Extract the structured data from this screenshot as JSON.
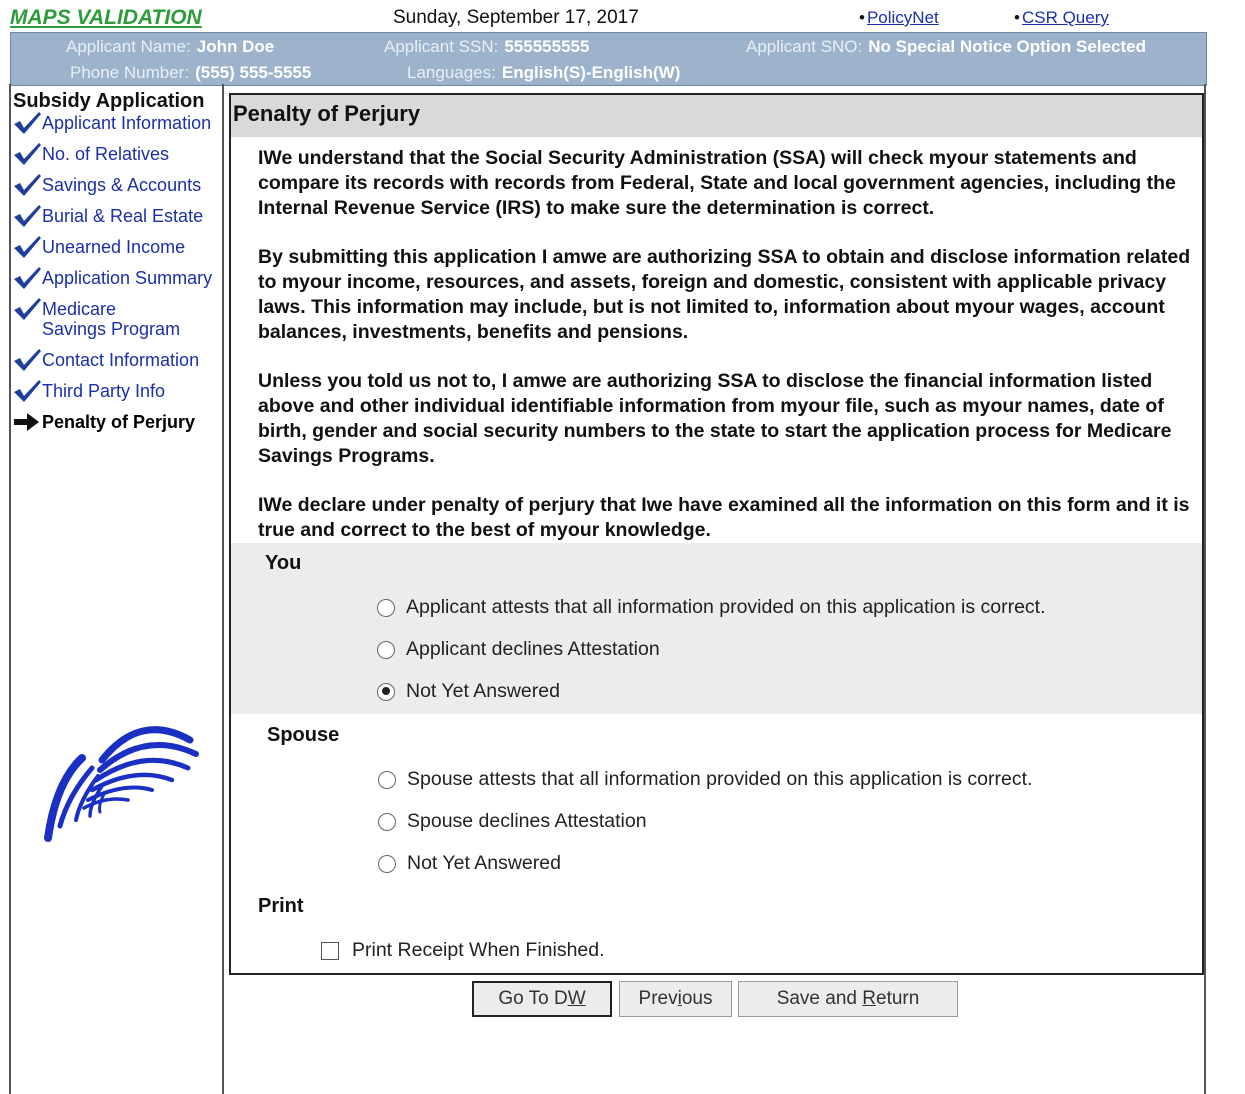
{
  "header": {
    "app_title": "MAPS VALIDATION",
    "date": "Sunday, September 17, 2017",
    "links": [
      {
        "bullet": "•",
        "label": "PolicyNet"
      },
      {
        "bullet": "•",
        "label": "CSR Query"
      }
    ]
  },
  "applicant": {
    "name_label": "Applicant Name:",
    "name_value": "John Doe",
    "ssn_label": "Applicant SSN:",
    "ssn_value": "555555555",
    "sno_label": "Applicant SNO:",
    "sno_value": "No Special Notice Option Selected",
    "phone_label": "Phone Number:",
    "phone_value": "(555) 555-5555",
    "languages_label": "Languages:",
    "languages_value": "English(S)-English(W)"
  },
  "sidebar": {
    "title": "Subsidy Application",
    "items": [
      {
        "label": "Applicant Information",
        "status": "complete"
      },
      {
        "label": "No. of Relatives",
        "status": "complete"
      },
      {
        "label": "Savings & Accounts",
        "status": "complete"
      },
      {
        "label": "Burial & Real Estate",
        "status": "complete"
      },
      {
        "label": "Unearned Income",
        "status": "complete"
      },
      {
        "label": "Application Summary",
        "status": "complete"
      },
      {
        "label": "Medicare Savings Program",
        "status": "complete"
      },
      {
        "label": "Contact Information",
        "status": "complete"
      },
      {
        "label": "Third Party Info",
        "status": "complete"
      },
      {
        "label": "Penalty of Perjury",
        "status": "current"
      }
    ]
  },
  "main": {
    "title": "Penalty of Perjury",
    "paragraphs": [
      "IWe understand that the Social Security Administration (SSA) will check myour statements and compare its records with records from Federal, State and local government agencies, including the Internal Revenue Service (IRS) to make sure the determination is correct.",
      "By submitting this application I amwe are authorizing SSA to obtain and disclose information related to myour income, resources, and assets, foreign and domestic, consistent with applicable privacy laws. This information may include, but is not limited to, information about myour wages, account balances, investments, benefits and pensions.",
      "Unless you told us not to, I amwe are authorizing SSA to disclose the financial information listed above and other individual identifiable information from myour file, such as myour names, date of birth, gender and social security numbers to the state to start the application process for Medicare Savings Programs.",
      "IWe declare under penalty of perjury that Iwe have examined all the information on this form and it is true and correct to the best of myour knowledge."
    ],
    "you": {
      "label": "You",
      "options": [
        "Applicant attests that all information provided on this application is correct.",
        "Applicant declines Attestation",
        "Not Yet Answered"
      ],
      "selected": 2
    },
    "spouse": {
      "label": "Spouse",
      "options": [
        "Spouse attests that all information provided on this application is correct.",
        "Spouse declines Attestation",
        "Not Yet Answered"
      ],
      "selected": null
    },
    "print": {
      "label": "Print",
      "checkbox_label": "Print Receipt When Finished.",
      "checked": false
    }
  },
  "buttons": {
    "go_to_dw": {
      "before": "Go To D",
      "accel": "W",
      "after": ""
    },
    "previous": {
      "before": "Prev",
      "accel": "i",
      "after": "ous"
    },
    "save_return": {
      "before": "Save and ",
      "accel": "R",
      "after": "eturn"
    }
  },
  "colors": {
    "title_green": "#2e9c3a",
    "header_bar": "#9db3cc",
    "link_blue": "#1b2fb0",
    "nav_blue": "#1c2fa8",
    "check_blue": "#1f3f9a"
  }
}
